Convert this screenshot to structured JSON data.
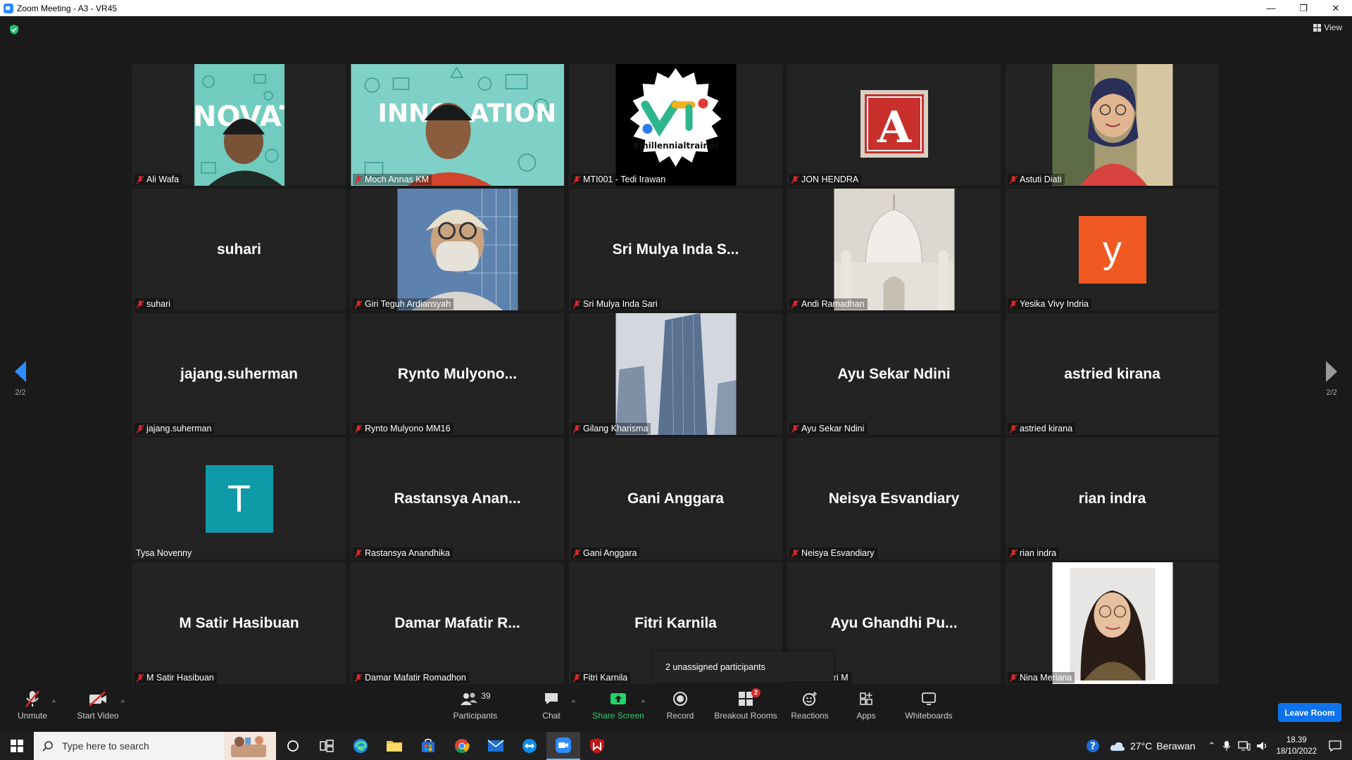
{
  "window": {
    "title": "Zoom Meeting - A3 - VR45",
    "controls": [
      "—",
      "❐",
      "✕"
    ]
  },
  "view_button": "View",
  "pagination": {
    "left": "2/2",
    "right": "2/2"
  },
  "tiles": [
    {
      "label": "Ali Wafa",
      "muted": true
    },
    {
      "label": "Moch Annas KM",
      "muted": true
    },
    {
      "label": "MTI001 - Tedi Irawan",
      "muted": true,
      "logo_text": "#millennialtrainer"
    },
    {
      "label": "JON HENDRA",
      "muted": true,
      "logo_letter": "A"
    },
    {
      "label": "Astuti Diati",
      "muted": true
    },
    {
      "label": "suhari",
      "muted": true,
      "display_name": "suhari"
    },
    {
      "label": "Giri Teguh Ardiansyah",
      "muted": true
    },
    {
      "label": "Sri Mulya Inda Sari",
      "muted": true,
      "display_name": "Sri Mulya Inda S..."
    },
    {
      "label": "Andi Ramadhan",
      "muted": true
    },
    {
      "label": "Yesika Vivy Indria",
      "muted": true,
      "avatar_letter": "y"
    },
    {
      "label": "jajang.suherman",
      "muted": true,
      "display_name": "jajang.suherman"
    },
    {
      "label": "Rynto Mulyono MM16",
      "muted": true,
      "display_name": "Rynto  Mulyono..."
    },
    {
      "label": "Gilang Kharisma",
      "muted": true
    },
    {
      "label": "Ayu Sekar Ndini",
      "muted": true,
      "display_name": "Ayu Sekar Ndini"
    },
    {
      "label": "astried kirana",
      "muted": true,
      "display_name": "astried kirana"
    },
    {
      "label": "Tysa Novenny",
      "muted": false,
      "avatar_letter": "T"
    },
    {
      "label": "Rastansya Anandhika",
      "muted": true,
      "display_name": "Rastansya  Anan..."
    },
    {
      "label": "Gani Anggara",
      "muted": true,
      "display_name": "Gani Anggara"
    },
    {
      "label": "Neisya Esvandiary",
      "muted": true,
      "display_name": "Neisya Esvandiary"
    },
    {
      "label": "rian indra",
      "muted": true,
      "display_name": "rian indra"
    },
    {
      "label": "M Satir Hasibuan",
      "muted": true,
      "display_name": "M Satir Hasibuan"
    },
    {
      "label": "Damar Mafatir Romadhon",
      "muted": true,
      "display_name": "Damar Mafatir R..."
    },
    {
      "label": "Fitri Karnila",
      "muted": true,
      "display_name": "Fitri Karnila"
    },
    {
      "label": "ndhi Putri M",
      "muted": true,
      "display_name": "Ayu Ghandhi Pu..."
    },
    {
      "label": "Nina Meriana",
      "muted": true
    }
  ],
  "popup": {
    "text": "2 unassigned participants"
  },
  "toolbar": {
    "unmute": "Unmute",
    "start_video": "Start Video",
    "participants": "Participants",
    "participants_count": "39",
    "chat": "Chat",
    "share_screen": "Share Screen",
    "record": "Record",
    "breakout_rooms": "Breakout Rooms",
    "breakout_badge": "2",
    "reactions": "Reactions",
    "apps": "Apps",
    "whiteboards": "Whiteboards",
    "leave_room": "Leave Room"
  },
  "taskbar": {
    "search_placeholder": "Type here to search",
    "weather_temp": "27°C",
    "weather_desc": "Berawan",
    "time": "18.39",
    "date": "18/10/2022"
  },
  "colors": {
    "accent_blue": "#2d8cff",
    "muted_red": "#e02828",
    "share_green": "#22d46a",
    "avatar_orange": "#f05a22",
    "avatar_teal": "#0e9aa7"
  }
}
